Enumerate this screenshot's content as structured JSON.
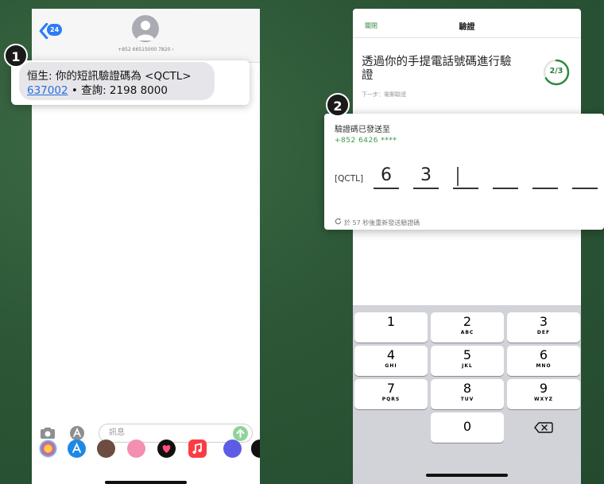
{
  "left_phone": {
    "back_badge": "24",
    "contact_number": "+852 66515000 7820 ›",
    "sms": {
      "line1": "恒生: 你的短訊驗證碼為 <QCTL>",
      "code": "637002",
      "line2_rest": " • 查詢: 2198 8000"
    },
    "compose_placeholder": "訊息"
  },
  "step_badges": {
    "first": "1",
    "second": "2"
  },
  "right_phone": {
    "close_label": "關閉",
    "title": "驗證",
    "instruction": "透過你的手提電話號碼進行驗證",
    "progress": "2/3",
    "progress_fraction": 0.667,
    "next_step": "下一步：電郵驗證",
    "code_sent_label": "驗證碼已發送至",
    "sent_phone": "+852 6426",
    "sent_phone_mask": " ****",
    "otp_prefix": "[QCTL]",
    "otp_digits": [
      "6",
      "3",
      "",
      "",
      "",
      ""
    ],
    "resend_text": "於 57 秒後重新發送驗證碼"
  },
  "keypad": {
    "keys": [
      {
        "num": "1",
        "sub": ""
      },
      {
        "num": "2",
        "sub": "ABC"
      },
      {
        "num": "3",
        "sub": "DEF"
      },
      {
        "num": "4",
        "sub": "GHI"
      },
      {
        "num": "5",
        "sub": "JKL"
      },
      {
        "num": "6",
        "sub": "MNO"
      },
      {
        "num": "7",
        "sub": "PQRS"
      },
      {
        "num": "8",
        "sub": "TUV"
      },
      {
        "num": "9",
        "sub": "WXYZ"
      },
      {
        "num": "0",
        "sub": ""
      }
    ]
  },
  "colors": {
    "background": "#2c5636",
    "accent_green": "#2e8b3e",
    "imessage_blue": "#2b7cf6",
    "link_blue": "#2b6fdc"
  }
}
